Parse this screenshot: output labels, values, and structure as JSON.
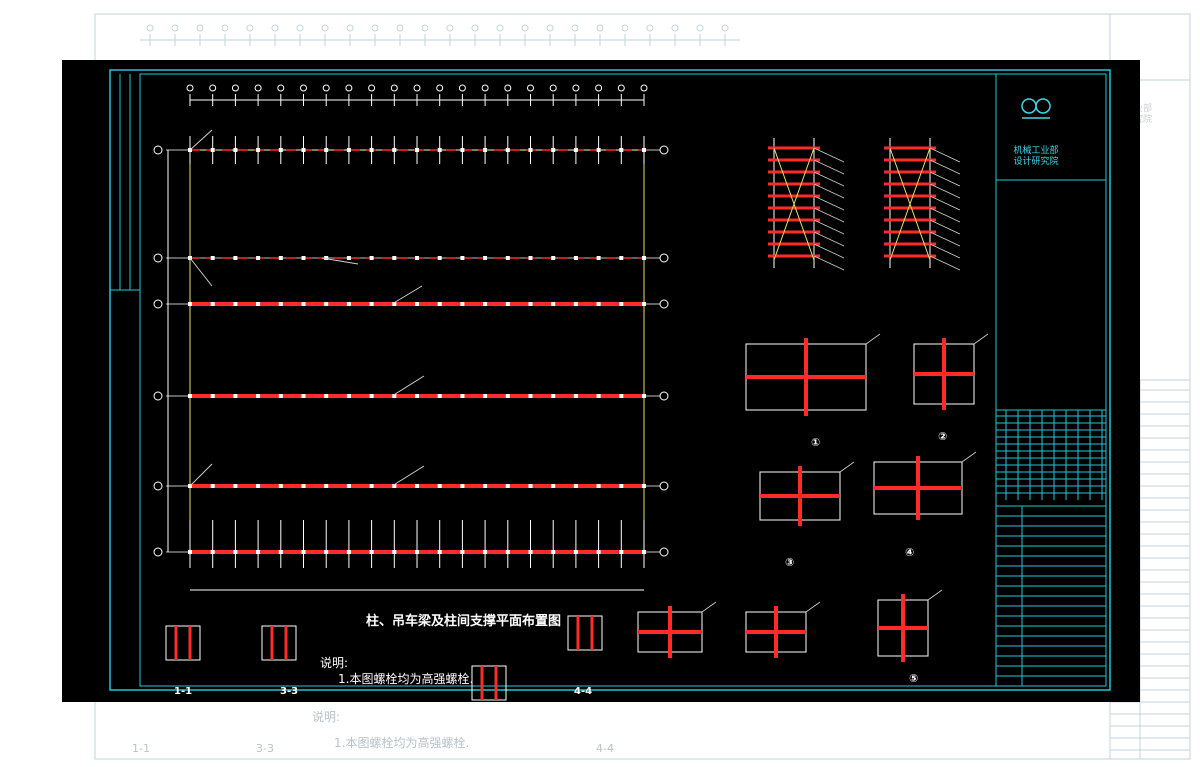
{
  "drawing": {
    "main_title": "柱、吊车梁及柱间支撑平面布置图",
    "notes_heading": "说明:",
    "notes": [
      "1.本图螺栓均为高强螺栓."
    ],
    "section_labels": [
      "1-1",
      "3-3",
      "4-4"
    ],
    "detail_numbers": [
      "①",
      "②",
      "③",
      "④",
      "⑤"
    ]
  },
  "title_block": {
    "institute_name": "机械工业部\n设计研究院"
  },
  "background": {
    "ghost_notes_heading": "说明:",
    "ghost_notes": [
      "1.本图螺栓均为高强螺栓."
    ],
    "ghost_section_labels": [
      "1-1",
      "3-3",
      "4-4"
    ],
    "ghost_institute_name": "工业部\n研究院"
  },
  "colors": {
    "sheet_background": "#000000",
    "frame": "#22c6d8",
    "beam": "#ff2a2a",
    "grid": "#ffffff",
    "axis_line": "#e8e26a",
    "leader": "#d0d0d0"
  }
}
